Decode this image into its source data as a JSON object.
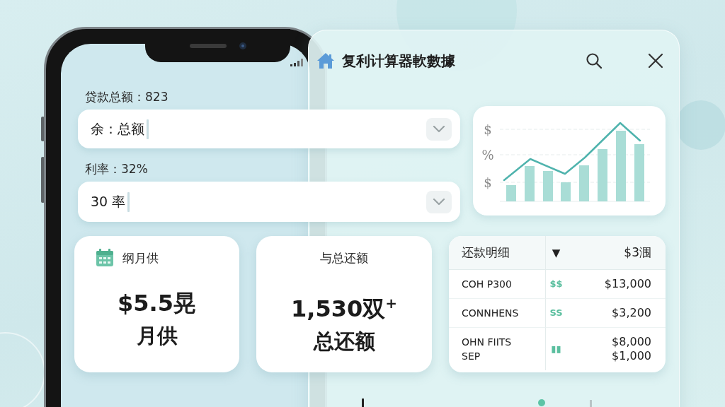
{
  "panel": {
    "title": "复利计算器軟數據"
  },
  "form": {
    "fields": [
      {
        "label": "贷款总额：823",
        "value": "余：总额"
      },
      {
        "label": "利率：32%",
        "value": "30 率"
      }
    ]
  },
  "chart": {
    "axis_labels": [
      "$",
      "%",
      "$"
    ]
  },
  "summary_cards": [
    {
      "kind": "icon_title",
      "title": "纲月供",
      "value": "$5.5晃",
      "caption": "月供"
    },
    {
      "kind": "centered_title",
      "title": "与总还额",
      "value": "1,530双$^{+}$",
      "caption": "总还额"
    }
  ],
  "table": {
    "columns": [
      "还款明细",
      "▼",
      "$3涠"
    ],
    "rows": [
      {
        "cells": [
          "COH P300",
          "$$",
          "$13,000"
        ]
      },
      {
        "cells": [
          "CONNHENS",
          "SS",
          "$3,200"
        ]
      },
      {
        "cells": [
          "OHN FIITS\nSEP",
          "▮▮",
          "$8,000\n$1,000"
        ]
      }
    ]
  }
}
